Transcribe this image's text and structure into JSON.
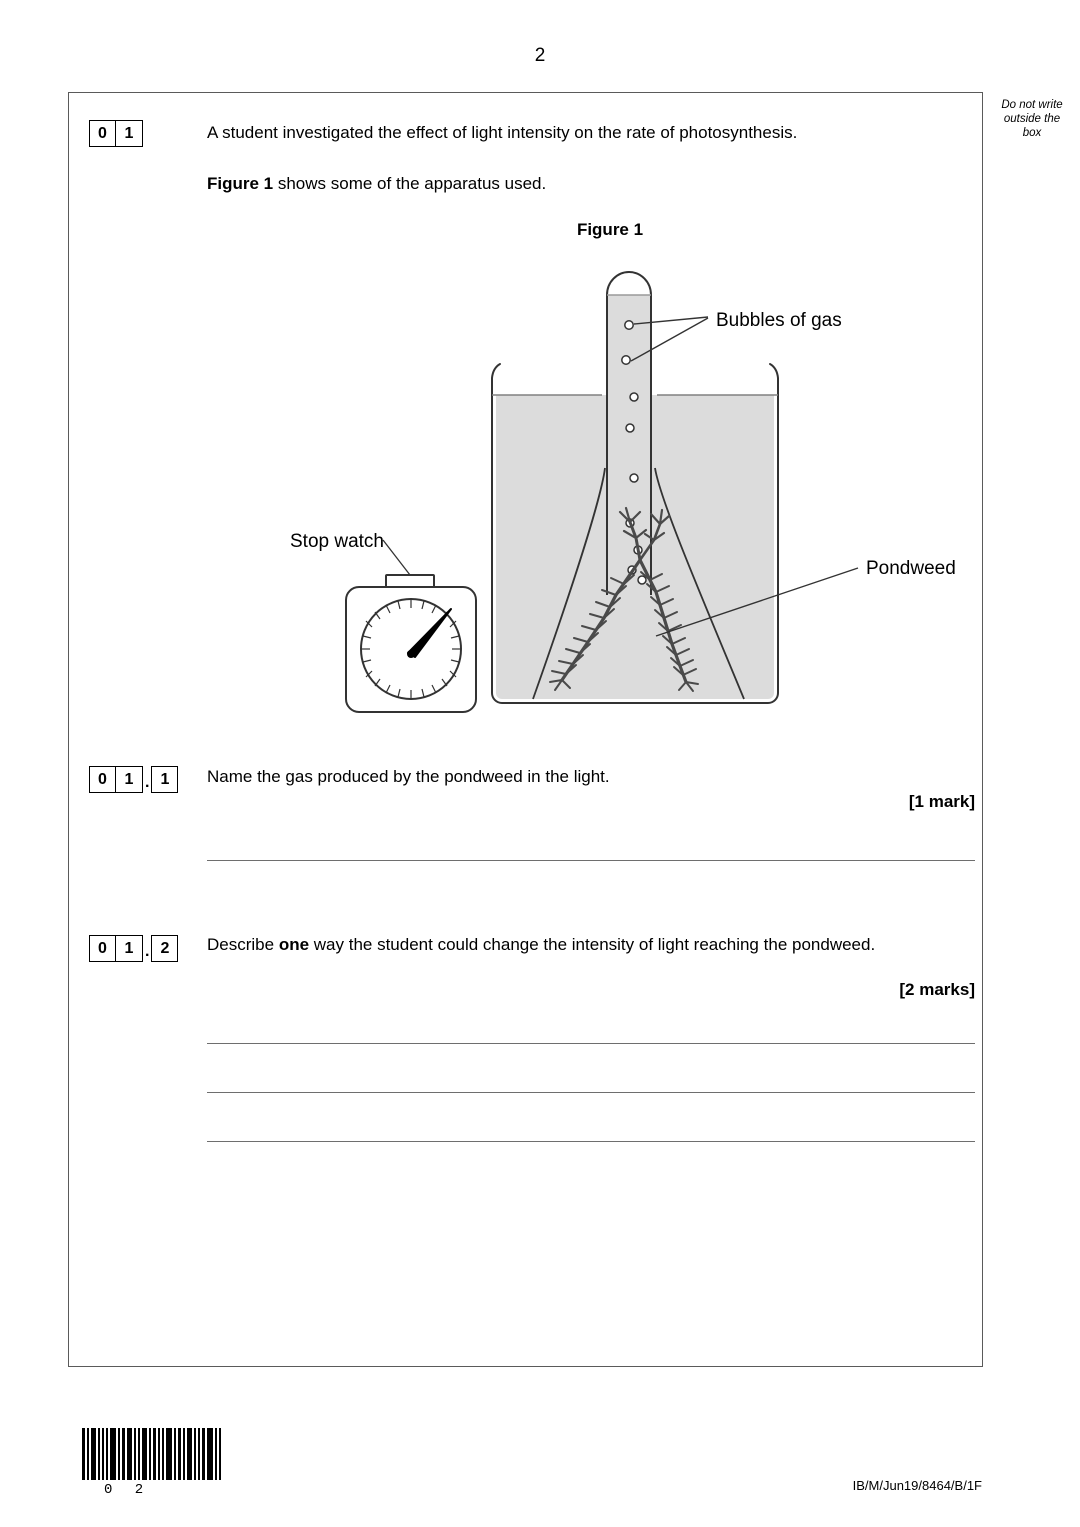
{
  "page": {
    "number": "2",
    "footer_reference": "IB/M/Jun19/8464/B/1F",
    "barcode_label": "0 2",
    "margin_note_line1": "Do not write",
    "margin_note_line2": "outside the",
    "margin_note_line3": "box"
  },
  "question_01": {
    "number_digits": [
      "0",
      "1"
    ],
    "stem": "A student investigated the effect of light intensity on the rate of photosynthesis.",
    "figure_intro_bold": "Figure 1",
    "figure_intro_rest": " shows some of the apparatus used.",
    "figure_title": "Figure 1"
  },
  "figure": {
    "label_bubbles": "Bubbles of gas",
    "label_pondweed": "Pondweed",
    "label_stopwatch": "Stop watch"
  },
  "question_01_1": {
    "number_digits": [
      "0",
      "1"
    ],
    "sub_digit": "1",
    "text": "Name the gas produced by the pondweed in the light.",
    "marks": "[1 mark]"
  },
  "question_01_2": {
    "number_digits": [
      "0",
      "1"
    ],
    "sub_digit": "2",
    "text_part1": "Describe ",
    "text_bold": "one",
    "text_part2": " way the student could change the intensity of light reaching",
    "text_line2": "the pondweed.",
    "marks": "[2 marks]"
  },
  "colors": {
    "fill_grey": "#dcdcdc",
    "outline": "#333333",
    "border": "#5a5a5a",
    "line": "#6e6e6e"
  }
}
